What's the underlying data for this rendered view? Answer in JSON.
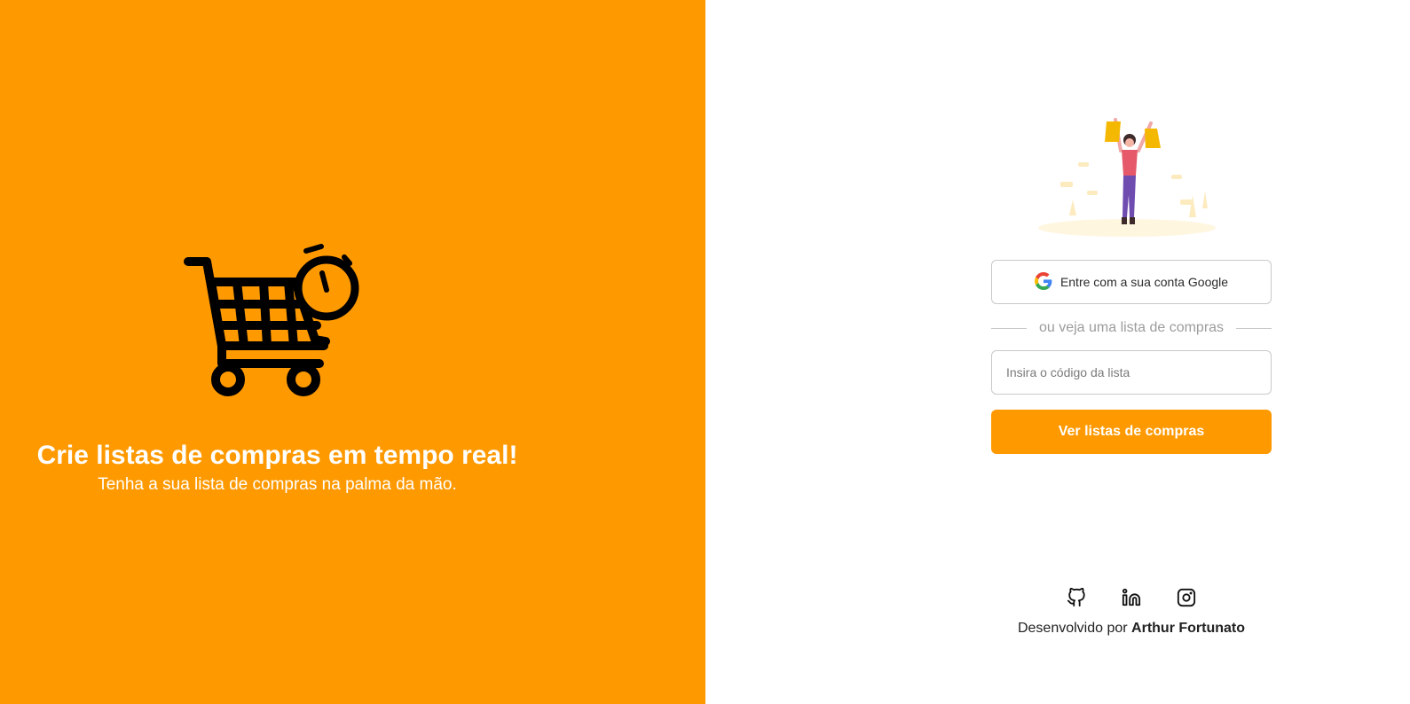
{
  "hero": {
    "title": "Crie listas de compras em tempo real!",
    "subtitle": "Tenha a sua lista de compras na palma da mão.",
    "icon": "shopping-cart-timer-icon"
  },
  "login": {
    "google_button_label": "Entre com a sua conta Google",
    "divider_text": "ou veja uma lista de compras",
    "code_placeholder": "Insira o código da lista",
    "code_value": "",
    "submit_label": "Ver listas de compras"
  },
  "footer": {
    "developed_by": "Desenvolvido por",
    "author": "Arthur Fortunato",
    "social_icons": [
      "github-icon",
      "linkedin-icon",
      "instagram-icon"
    ]
  },
  "colors": {
    "brand": "#FF9900",
    "background": "#ffffff",
    "border": "#c9c9c9"
  }
}
